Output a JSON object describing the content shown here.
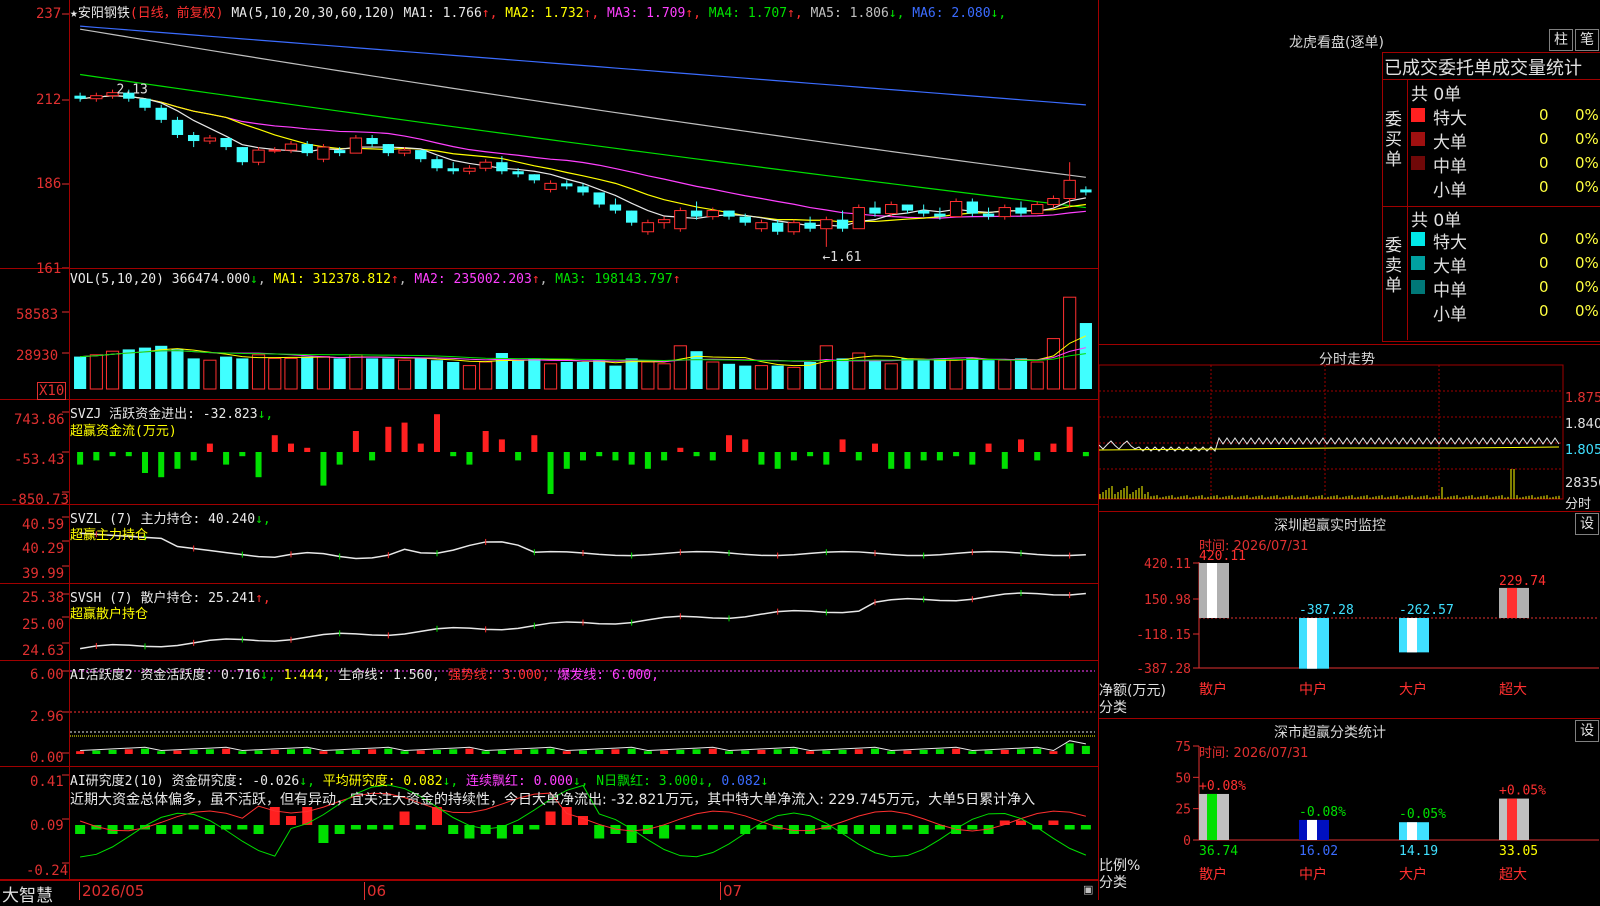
{
  "stock": {
    "title": "★安阳钢铁",
    "mode": "(日线，前复权)",
    "ma_label": "MA(5,10,20,30,60,120)",
    "ma": [
      {
        "name": "MA1",
        "value": "1.766",
        "arrow": "↑",
        "color": "#e8e8e8"
      },
      {
        "name": "MA2",
        "value": "1.732",
        "arrow": "↑",
        "color": "#ffff00"
      },
      {
        "name": "MA3",
        "value": "1.709",
        "arrow": "↑",
        "color": "#ff40ff"
      },
      {
        "name": "MA4",
        "value": "1.707",
        "arrow": "↑",
        "color": "#00e000"
      },
      {
        "name": "MA5",
        "value": "1.806",
        "arrow": "↓",
        "color": "#c0c0c0"
      },
      {
        "name": "MA6",
        "value": "2.080",
        "arrow": "↓",
        "color": "#3b6cff"
      }
    ],
    "high_mark": "2.13",
    "low_mark": "←1.61",
    "price_axis": [
      "237",
      "212",
      "186",
      "161"
    ]
  },
  "volume": {
    "label": "VOL(5,10,20)",
    "value": "366474.000",
    "value_arrow": "↓",
    "ma1": "MA1: 312378.812",
    "ma2": "MA2: 235002.203",
    "ma3": "MA3: 198143.797",
    "axis": [
      "58583",
      "28930"
    ],
    "unit": "X10"
  },
  "svzj": {
    "label": "SVZJ",
    "text": "活跃资金进出: -32.823",
    "arrow": "↓,",
    "sub": "超赢资金流(万元)",
    "axis": [
      "743.86",
      "-53.43",
      "-850.73"
    ]
  },
  "svzl": {
    "label": "SVZL (7)",
    "text": "主力持仓: 40.240",
    "arrow": "↓,",
    "sub": "超赢主力持仓",
    "axis": [
      "40.59",
      "40.29",
      "39.99"
    ]
  },
  "svsh": {
    "label": "SVSH (7)",
    "text": "散户持仓: 25.241",
    "arrow": "↑,",
    "sub": "超赢散户持仓",
    "axis": [
      "25.38",
      "25.00",
      "24.63"
    ]
  },
  "ai_active": {
    "label": "AI活跃度2",
    "text1": "资金活跃度: 0.716",
    "t1arrow": "↓,",
    "text2": "1.444,",
    "text3": "生命线: 1.560,",
    "text4": "强势线: 3.000,",
    "text5": "爆发线: 6.000,",
    "axis": [
      "6.00",
      "2.96",
      "0.00"
    ]
  },
  "ai_research": {
    "label": "AI研究度2(10)",
    "text1": "资金研究度: -0.026",
    "t1arrow": "↓,",
    "text2": "平均研究度: 0.082",
    "t2arrow": "↓,",
    "text3": "连续飘红: 0.000",
    "t3arrow": "↓,",
    "text4": "N日飘红: 3.000",
    "t4arrow": "↓,",
    "text5": "0.082",
    "t5arrow": "↓",
    "summary": "近期大资金总体偏多，虽不活跃，但有异动，宜关注大资金的持续性，今日大单净流出: -32.821万元，其中特大单净流入: 229.745万元，大单5日累计净入",
    "axis": [
      "0.41",
      "0.09",
      "-0.24"
    ]
  },
  "bottom": {
    "brand": "大智慧",
    "dates": [
      "2026/05",
      "06",
      "07"
    ]
  },
  "dragon": {
    "title": "龙虎看盘(逐单)",
    "btn1": "柱",
    "btn2": "笔",
    "subtitle": "已成交委托单成交量统计",
    "buy_label": "委买单",
    "sell_label": "委卖单",
    "buy_total": "共 0单",
    "sell_total": "共 0单",
    "buy_rows": [
      {
        "name": "特大",
        "count": "0",
        "pct": "0%",
        "color": "#ff2020"
      },
      {
        "name": "大单",
        "count": "0",
        "pct": "0%",
        "color": "#a01010"
      },
      {
        "name": "中单",
        "count": "0",
        "pct": "0%",
        "color": "#700808"
      },
      {
        "name": "小单",
        "count": "0",
        "pct": "0%",
        "color": "#000000"
      }
    ],
    "sell_rows": [
      {
        "name": "特大",
        "count": "0",
        "pct": "0%",
        "color": "#00e8e8"
      },
      {
        "name": "大单",
        "count": "0",
        "pct": "0%",
        "color": "#00a0a0"
      },
      {
        "name": "中单",
        "count": "0",
        "pct": "0%",
        "color": "#007878"
      },
      {
        "name": "小单",
        "count": "0",
        "pct": "0%",
        "color": "#000000"
      }
    ]
  },
  "intraday": {
    "title": "分时走势",
    "axis": [
      "1.875",
      "1.840",
      "1.805",
      "28356"
    ],
    "label": "分时"
  },
  "monitor": {
    "title": "深圳超赢实时监控",
    "btn": "设",
    "time": "时间: 2026/07/31",
    "axis": [
      "420.11",
      "150.98",
      "-118.15",
      "-387.28"
    ],
    "ylabel": "净额(万元)",
    "xlabel": "分类",
    "categories": [
      "散户",
      "中户",
      "大户",
      "超大"
    ],
    "values": [
      420.11,
      -387.28,
      -262.57,
      229.74
    ],
    "value_labels": [
      "420.11",
      "-387.28",
      "-262.57",
      "229.74"
    ]
  },
  "classify": {
    "title": "深市超赢分类统计",
    "btn": "设",
    "time": "时间: 2026/07/31",
    "axis": [
      "75",
      "50",
      "25",
      "0"
    ],
    "ylabel": "比例%",
    "xlabel": "分类",
    "categories": [
      "散户",
      "中户",
      "大户",
      "超大"
    ],
    "values": [
      36.74,
      16.02,
      14.19,
      33.05
    ],
    "value_labels": [
      "36.74",
      "16.02",
      "14.19",
      "33.05"
    ],
    "changes": [
      "+0.08%",
      "-0.08%",
      "-0.05%",
      "+0.05%"
    ]
  },
  "chart_data": [
    {
      "type": "candlestick",
      "title": "安阳钢铁",
      "ylim": [
        1.55,
        2.4
      ],
      "high_label": 2.13,
      "low_label": 1.61,
      "x_ticks": [
        "2026/05",
        "06",
        "07"
      ],
      "series": [
        {
          "name": "K",
          "ohlc": [
            [
              2.11,
              2.12,
              2.09,
              2.1
            ],
            [
              2.1,
              2.12,
              2.09,
              2.11
            ],
            [
              2.11,
              2.13,
              2.1,
              2.12
            ],
            [
              2.12,
              2.13,
              2.09,
              2.1
            ],
            [
              2.1,
              2.1,
              2.06,
              2.07
            ],
            [
              2.07,
              2.08,
              2.02,
              2.03
            ],
            [
              2.03,
              2.04,
              1.97,
              1.98
            ],
            [
              1.98,
              1.99,
              1.94,
              1.96
            ],
            [
              1.96,
              1.98,
              1.95,
              1.97
            ],
            [
              1.97,
              1.97,
              1.93,
              1.94
            ],
            [
              1.94,
              1.94,
              1.88,
              1.89
            ],
            [
              1.89,
              1.94,
              1.88,
              1.93
            ],
            [
              1.93,
              1.94,
              1.92,
              1.93
            ],
            [
              1.93,
              1.96,
              1.92,
              1.95
            ],
            [
              1.95,
              1.96,
              1.91,
              1.92
            ],
            [
              1.9,
              1.95,
              1.89,
              1.94
            ],
            [
              1.93,
              1.94,
              1.91,
              1.92
            ],
            [
              1.92,
              1.98,
              1.92,
              1.97
            ],
            [
              1.97,
              1.98,
              1.94,
              1.95
            ],
            [
              1.95,
              1.95,
              1.91,
              1.92
            ],
            [
              1.92,
              1.94,
              1.91,
              1.93
            ],
            [
              1.93,
              1.93,
              1.89,
              1.9
            ],
            [
              1.9,
              1.91,
              1.86,
              1.87
            ],
            [
              1.87,
              1.89,
              1.85,
              1.86
            ],
            [
              1.86,
              1.88,
              1.85,
              1.87
            ],
            [
              1.87,
              1.9,
              1.86,
              1.89
            ],
            [
              1.89,
              1.91,
              1.85,
              1.86
            ],
            [
              1.86,
              1.87,
              1.84,
              1.85
            ],
            [
              1.85,
              1.85,
              1.82,
              1.83
            ],
            [
              1.8,
              1.83,
              1.79,
              1.82
            ],
            [
              1.82,
              1.83,
              1.8,
              1.81
            ],
            [
              1.81,
              1.82,
              1.78,
              1.79
            ],
            [
              1.79,
              1.79,
              1.74,
              1.75
            ],
            [
              1.75,
              1.77,
              1.72,
              1.73
            ],
            [
              1.73,
              1.73,
              1.68,
              1.69
            ],
            [
              1.66,
              1.7,
              1.65,
              1.69
            ],
            [
              1.69,
              1.71,
              1.67,
              1.7
            ],
            [
              1.67,
              1.74,
              1.66,
              1.73
            ],
            [
              1.73,
              1.76,
              1.7,
              1.71
            ],
            [
              1.71,
              1.74,
              1.7,
              1.73
            ],
            [
              1.73,
              1.73,
              1.7,
              1.71
            ],
            [
              1.71,
              1.72,
              1.68,
              1.69
            ],
            [
              1.67,
              1.7,
              1.66,
              1.69
            ],
            [
              1.69,
              1.7,
              1.65,
              1.66
            ],
            [
              1.66,
              1.7,
              1.65,
              1.69
            ],
            [
              1.69,
              1.71,
              1.66,
              1.67
            ],
            [
              1.67,
              1.71,
              1.61,
              1.7
            ],
            [
              1.7,
              1.73,
              1.66,
              1.67
            ],
            [
              1.67,
              1.75,
              1.67,
              1.74
            ],
            [
              1.74,
              1.76,
              1.71,
              1.72
            ],
            [
              1.72,
              1.76,
              1.71,
              1.75
            ],
            [
              1.75,
              1.75,
              1.72,
              1.73
            ],
            [
              1.73,
              1.75,
              1.71,
              1.72
            ],
            [
              1.72,
              1.74,
              1.7,
              1.71
            ],
            [
              1.71,
              1.77,
              1.71,
              1.76
            ],
            [
              1.76,
              1.77,
              1.71,
              1.72
            ],
            [
              1.72,
              1.74,
              1.7,
              1.71
            ],
            [
              1.71,
              1.75,
              1.7,
              1.74
            ],
            [
              1.74,
              1.76,
              1.71,
              1.72
            ],
            [
              1.72,
              1.76,
              1.72,
              1.75
            ],
            [
              1.75,
              1.78,
              1.74,
              1.77
            ],
            [
              1.77,
              1.89,
              1.74,
              1.83
            ],
            [
              1.8,
              1.81,
              1.78,
              1.79
            ]
          ]
        }
      ]
    },
    {
      "type": "bar",
      "title": "VOL(5,10,20)",
      "ylim": [
        0,
        60000
      ],
      "series": [
        {
          "name": "VOL",
          "values": [
            18000,
            19000,
            21000,
            22000,
            23000,
            24000,
            22000,
            17000,
            16000,
            18000,
            17000,
            19000,
            17000,
            17000,
            18000,
            18000,
            17000,
            19000,
            17000,
            17000,
            16000,
            17000,
            16000,
            15000,
            13000,
            15000,
            20000,
            16000,
            17000,
            14000,
            15000,
            15000,
            16000,
            13000,
            17000,
            15000,
            14000,
            24000,
            21000,
            15000,
            14000,
            13000,
            13000,
            13000,
            12000,
            15000,
            24000,
            17000,
            20000,
            16000,
            14000,
            17000,
            16000,
            17000,
            16000,
            17000,
            16000,
            16000,
            17000,
            15000,
            28000,
            51000,
            36647
          ]
        }
      ]
    }
  ]
}
